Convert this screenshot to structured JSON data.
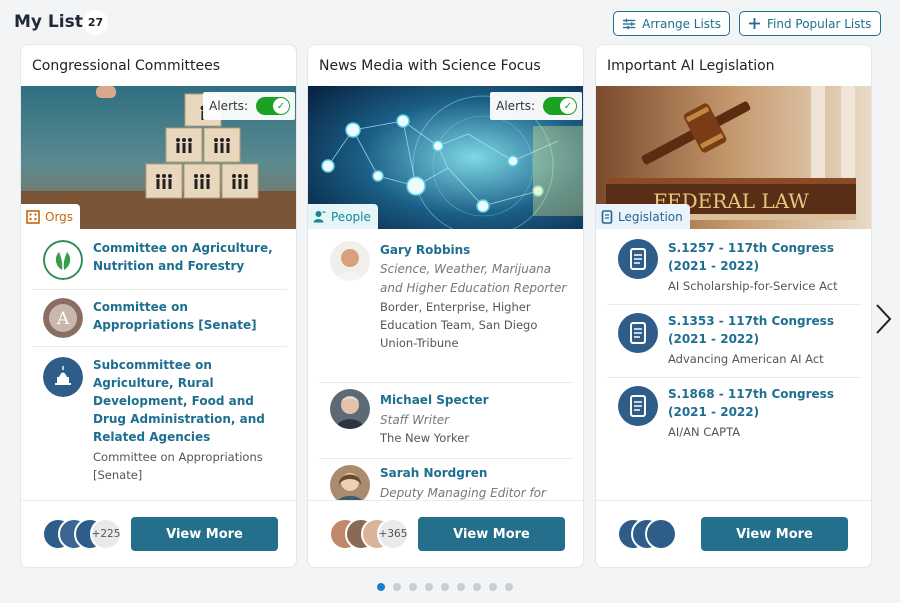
{
  "header": {
    "title": "My Lists",
    "count": "27",
    "arrange_label": "Arrange Lists",
    "popular_label": "Find Popular Lists"
  },
  "alerts_label": "Alerts:",
  "view_more_label": "View More",
  "cards": [
    {
      "title": "Congressional Committees",
      "type": "Orgs",
      "type_icon": "building-icon",
      "image": "wooden-blocks-people-icons",
      "more_count": "+225",
      "items": [
        {
          "name": "Committee on Agriculture, Nutrition and Forestry",
          "icon": "leaf-seal-icon"
        },
        {
          "name": "Committee on Appropriations [Senate]",
          "icon": "senate-seal-icon"
        },
        {
          "name": "Subcommittee on Agriculture, Rural Development, Food and Drug Administration, and Related Agencies",
          "sub": "Committee on Appropriations [Senate]",
          "icon": "capitol-icon"
        }
      ]
    },
    {
      "title": "News Media with Science Focus",
      "type": "People",
      "type_icon": "person-icon",
      "image": "digital-network-globe",
      "more_count": "+365",
      "items": [
        {
          "name": "Gary Robbins",
          "role": "Science, Weather, Marijuana and Higher Education Reporter",
          "sub": "Border, Enterprise, Higher Education Team, San Diego Union-Tribune"
        },
        {
          "name": "Michael Specter",
          "role": "Staff Writer",
          "sub": "The New Yorker"
        },
        {
          "name": "Sarah Nordgren",
          "role": "Deputy Managing Editor for"
        }
      ]
    },
    {
      "title": "Important AI Legislation",
      "type": "Legislation",
      "type_icon": "scroll-icon",
      "image": "gavel-federal-law-book",
      "image_text": "FEDERAL LAW",
      "items": [
        {
          "name": "S.1257 - 117th Congress (2021 - 2022)",
          "sub": "AI Scholarship-for-Service Act"
        },
        {
          "name": "S.1353 - 117th Congress (2021 - 2022)",
          "sub": "Advancing American AI Act"
        },
        {
          "name": "S.1868 - 117th Congress (2021 - 2022)",
          "sub": "AI/AN CAPTA"
        }
      ]
    }
  ],
  "pagination": {
    "pages": 9,
    "active": 1
  },
  "colors": {
    "accent": "#236f8c",
    "link": "#1e6f8f",
    "toggle_on": "#1aa322",
    "orgs": "#c7650f",
    "people": "#12889a",
    "active_dot": "#1a7fd4"
  }
}
